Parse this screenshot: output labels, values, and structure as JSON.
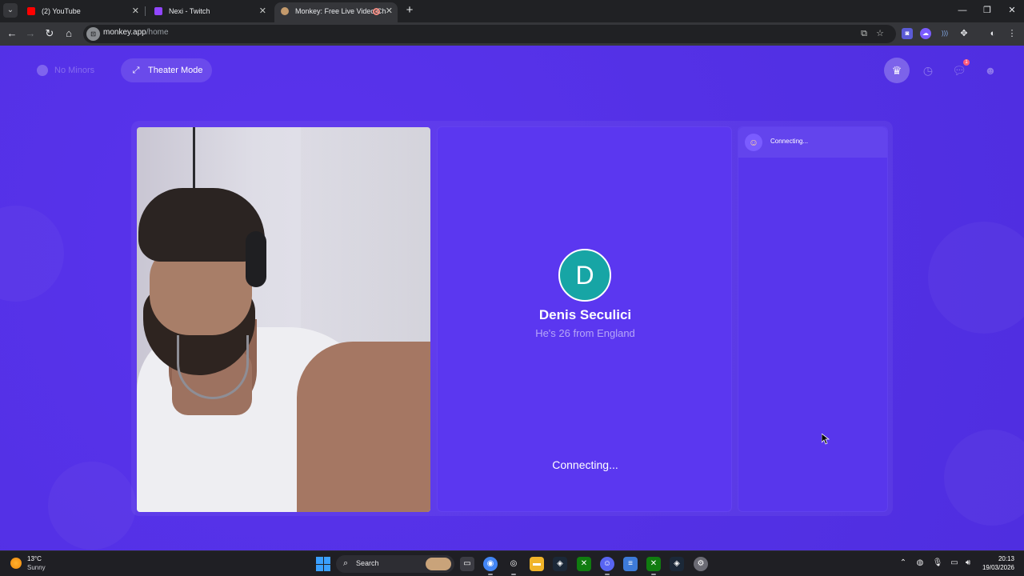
{
  "browser": {
    "tabs": [
      {
        "title": "(2) YouTube",
        "icon": "youtube-icon",
        "color": "#ff0000"
      },
      {
        "title": "Nexi - Twitch",
        "icon": "twitch-icon",
        "color": "#9146ff"
      },
      {
        "title": "Monkey: Free Live Video Ch",
        "icon": "monkey-icon",
        "color": "#c49a6c",
        "active": true
      }
    ],
    "new_tab": "+",
    "url_host": "monkey.app",
    "url_path": "/home"
  },
  "page": {
    "no_minors_label": "No Minors",
    "theater_mode_label": "Theater Mode",
    "chat_badge": "1",
    "profile": {
      "initial": "D",
      "name": "Denis Seculici",
      "subtitle": "He's 26 from England",
      "status": "Connecting...",
      "avatar_color": "#17a5a5"
    },
    "chat": {
      "status": "Connecting..."
    },
    "accent": "#5431e6"
  },
  "taskbar": {
    "weather_temp": "13°C",
    "weather_cond": "Sunny",
    "search_label": "Search",
    "time": "20:13",
    "date": "19/03/2026"
  }
}
